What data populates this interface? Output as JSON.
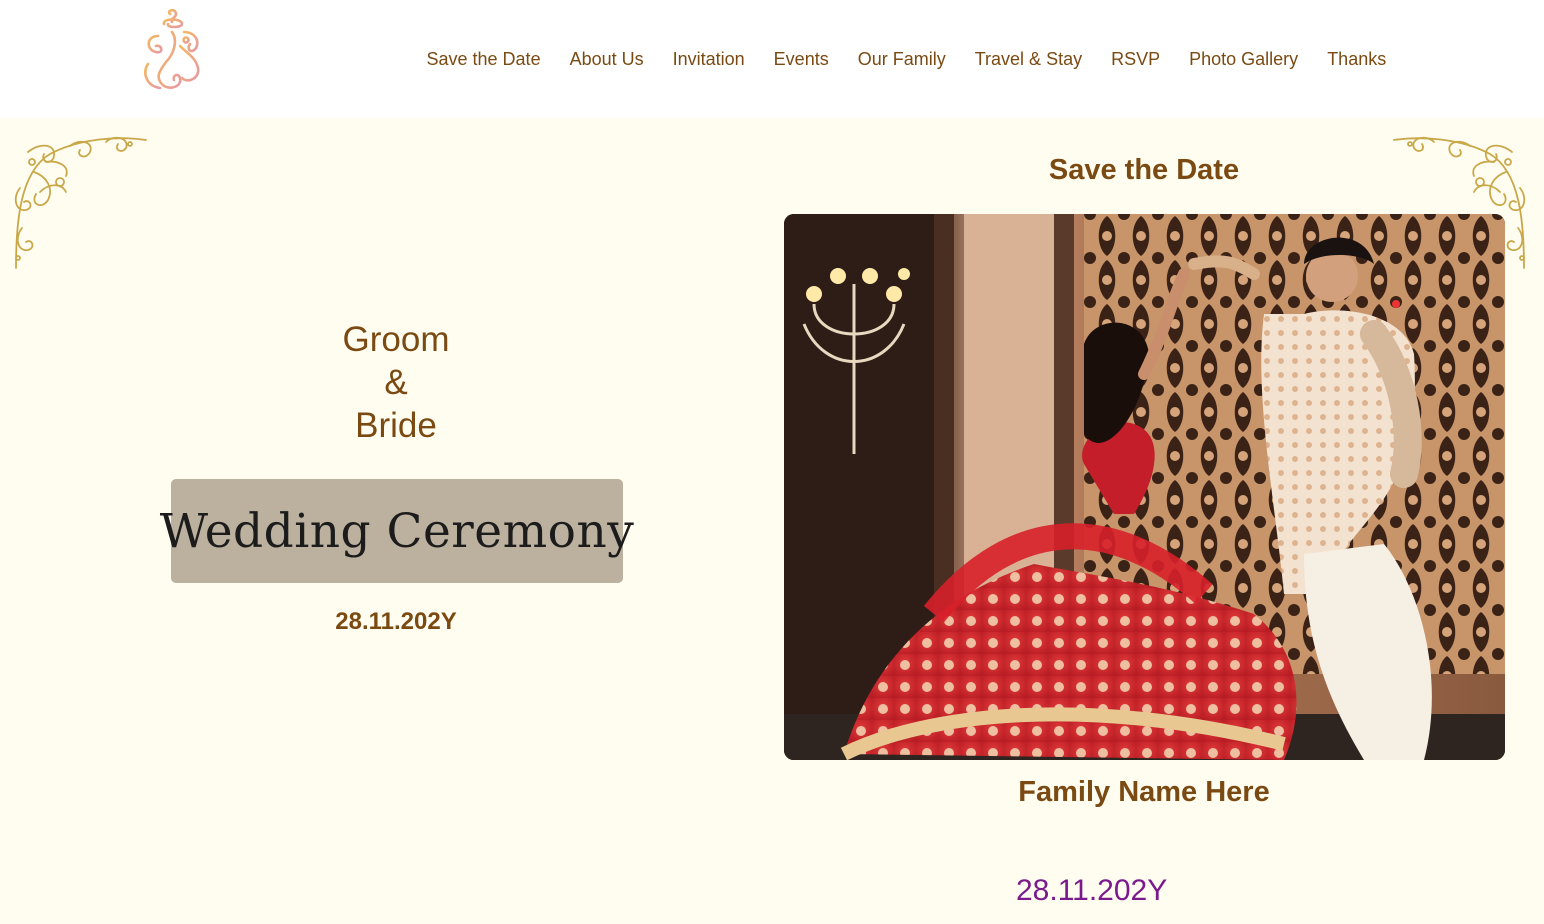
{
  "header": {
    "logo_icon": "ganesha-logo-icon",
    "nav": [
      {
        "label": "Save the Date"
      },
      {
        "label": "About Us"
      },
      {
        "label": "Invitation"
      },
      {
        "label": "Events"
      },
      {
        "label": "Our Family"
      },
      {
        "label": "Travel & Stay"
      },
      {
        "label": "RSVP"
      },
      {
        "label": "Photo Gallery"
      },
      {
        "label": "Thanks"
      }
    ]
  },
  "hero": {
    "groom": "Groom",
    "ampersand": "&",
    "bride": "Bride",
    "ceremony_title": "Wedding Ceremony",
    "date": "28.11.202Y"
  },
  "save_the_date": {
    "heading": "Save the Date",
    "photo_icon": "couple-dancing-photo",
    "family_name": "Family Name Here",
    "date": "28.11.202Y"
  },
  "colors": {
    "accent_brown": "#7a4a12",
    "page_background": "#fffdf0",
    "ceremony_box": "#bcb09e",
    "date_purple": "#7a1a8c",
    "gold_ornament": "#c9a84a"
  }
}
